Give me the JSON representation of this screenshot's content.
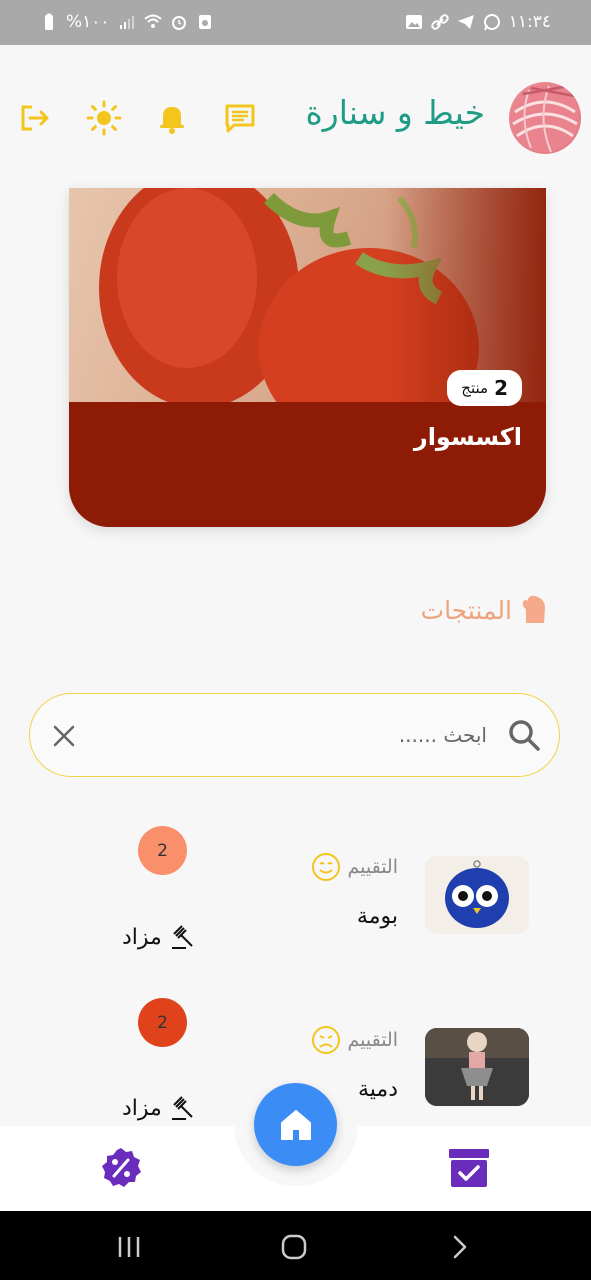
{
  "status_bar": {
    "time": "١١:٣٤",
    "battery": "%١٠٠"
  },
  "header": {
    "app_title": "خيط و سنارة",
    "icons": [
      "exit-icon",
      "sun-icon",
      "bell-icon",
      "chat-icon"
    ]
  },
  "category": {
    "name": "اكسسوار",
    "count": "2",
    "count_unit": "منتج"
  },
  "products_section": {
    "title": "المنتجات"
  },
  "search": {
    "placeholder": "ابحث ......",
    "value": ""
  },
  "products": [
    {
      "name": "بومة",
      "rating_label": "التقييم",
      "rating_mood": "happy",
      "bid_count": "2",
      "bid_color": "#f98f6b",
      "auction_label": "مزاد"
    },
    {
      "name": "دمية",
      "rating_label": "التقييم",
      "rating_mood": "sad",
      "bid_count": "2",
      "bid_color": "#e0421c",
      "auction_label": "مزاد"
    }
  ],
  "bottom_nav": {
    "items": [
      "discount-icon",
      "home-icon",
      "orders-icon"
    ]
  },
  "colors": {
    "accent_yellow": "#f4c51d",
    "title_teal": "#1e9c86",
    "category_bg": "#8d1b05",
    "section_title": "#f0a17e",
    "nav_purple": "#6a2dbb",
    "home_blue": "#3b8cf5"
  }
}
